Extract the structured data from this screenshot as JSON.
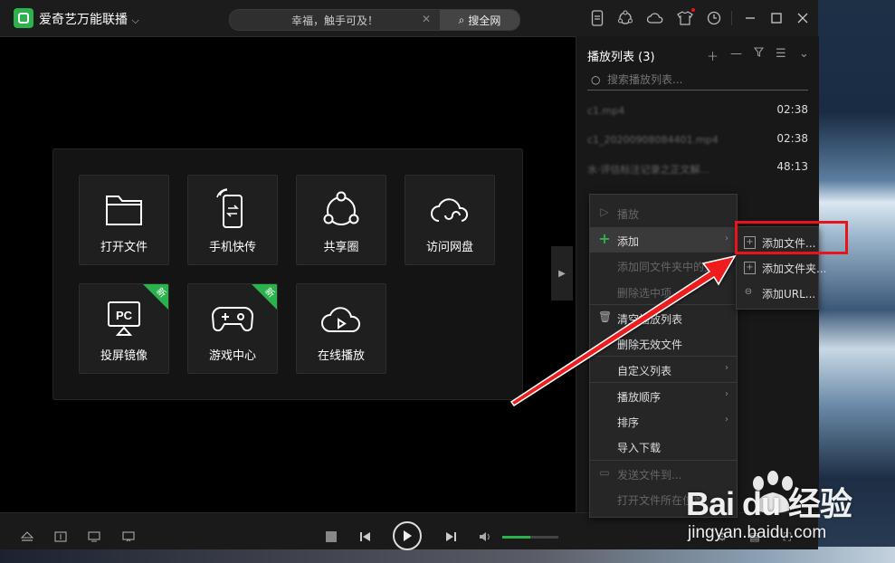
{
  "app": {
    "title": "爱奇艺万能联播",
    "title_chevron": "⌵"
  },
  "search": {
    "placeholder": "幸福，触手可及！",
    "value": "幸福，触手可及！",
    "button_label": "搜全网"
  },
  "toolbar_icons": [
    "phone-sync-icon",
    "share-circle-icon",
    "cloud-icon",
    "skin-shirt-icon",
    "clock-icon"
  ],
  "window_controls": [
    "minimize-icon",
    "maximize-icon",
    "close-icon"
  ],
  "tiles": [
    {
      "label": "打开文件",
      "icon": "folder-icon",
      "badge": ""
    },
    {
      "label": "手机快传",
      "icon": "phone-transfer-icon",
      "badge": ""
    },
    {
      "label": "共享圈",
      "icon": "share-circle-icon",
      "badge": ""
    },
    {
      "label": "访问网盘",
      "icon": "cloud-drive-icon",
      "badge": ""
    },
    {
      "label": "投屏镜像",
      "icon": "pc-cast-icon",
      "badge": "新"
    },
    {
      "label": "游戏中心",
      "icon": "gamepad-icon",
      "badge": "新"
    },
    {
      "label": "在线播放",
      "icon": "cloud-play-icon",
      "badge": ""
    }
  ],
  "playlist": {
    "title": "播放列表 (3)",
    "search_placeholder": "搜索播放列表...",
    "items": [
      {
        "name": "c1.mp4",
        "duration": "02:38"
      },
      {
        "name": "c1_20200908084401.mp4",
        "duration": "02:38"
      },
      {
        "name": "水·评估标注记录之正文解...",
        "duration": "48:13"
      }
    ]
  },
  "context_menu": {
    "items": [
      {
        "label": "播放",
        "enabled": false,
        "has_submenu": false,
        "icon": "play-circle-icon"
      },
      {
        "label": "添加",
        "enabled": true,
        "has_submenu": true,
        "icon": "plus-icon",
        "highlighted": true
      },
      {
        "label": "添加同文件夹中的文件",
        "enabled": false,
        "has_submenu": false,
        "icon": ""
      },
      {
        "label": "删除选中项",
        "enabled": false,
        "has_submenu": false,
        "icon": ""
      },
      {
        "label": "清空播放列表",
        "enabled": true,
        "has_submenu": false,
        "icon": "trash-icon"
      },
      {
        "label": "删除无效文件",
        "enabled": true,
        "has_submenu": false,
        "icon": ""
      },
      {
        "label": "自定义列表",
        "enabled": true,
        "has_submenu": true,
        "icon": ""
      },
      {
        "label": "播放顺序",
        "enabled": true,
        "has_submenu": true,
        "icon": ""
      },
      {
        "label": "排序",
        "enabled": true,
        "has_submenu": true,
        "icon": ""
      },
      {
        "label": "导入下载",
        "enabled": true,
        "has_submenu": false,
        "icon": ""
      },
      {
        "label": "发送文件到...",
        "enabled": false,
        "has_submenu": false,
        "icon": "send-folder-icon"
      },
      {
        "label": "打开文件所在位置",
        "enabled": false,
        "has_submenu": false,
        "icon": ""
      }
    ]
  },
  "submenu": {
    "items": [
      {
        "label": "添加文件...",
        "icon": "add-file-icon"
      },
      {
        "label": "添加文件夹...",
        "icon": "add-folder-icon"
      },
      {
        "label": "添加URL...",
        "icon": "link-icon"
      }
    ]
  },
  "controls": {
    "volume": 0.5
  },
  "watermark": {
    "brand": "Bai du 经验",
    "url": "jingyan.baidu.com"
  },
  "colors": {
    "accent_green": "#2bb24c",
    "annotation_red": "#e8141a"
  }
}
